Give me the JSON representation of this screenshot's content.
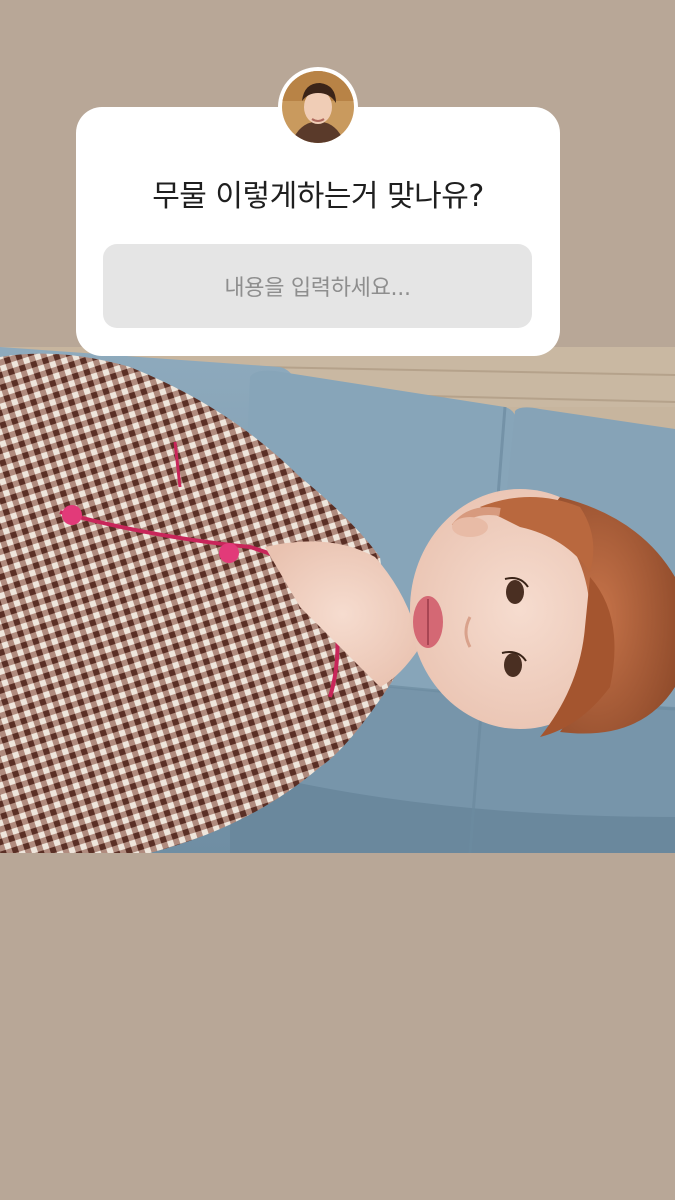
{
  "story": {
    "background_color": "#b8a797"
  },
  "question_sticker": {
    "avatar": "profile-photo",
    "question_text": "무물 이렇게하는거 맞나유?",
    "answer_placeholder": "내용을 입력하세요..."
  },
  "photo": {
    "subject": "person-lying-on-blue-sofa",
    "colors": {
      "sofa": "#7f9db1",
      "shirt_check": "#6b3f32",
      "piping": "#c8265a",
      "hair": "#b8643a",
      "floor": "#c7b59e"
    }
  }
}
